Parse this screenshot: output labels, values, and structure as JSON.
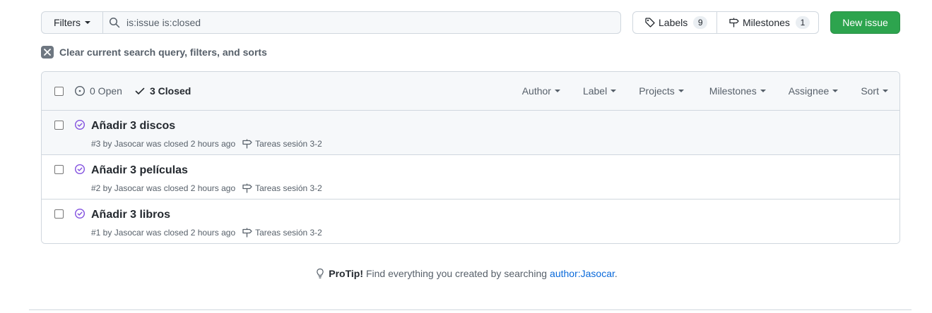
{
  "toolbar": {
    "filters_label": "Filters",
    "search_value": "is:issue is:closed",
    "labels_label": "Labels",
    "labels_count": "9",
    "milestones_label": "Milestones",
    "milestones_count": "1",
    "new_issue_label": "New issue"
  },
  "clear_filters": "Clear current search query, filters, and sorts",
  "list_header": {
    "open_label": "0 Open",
    "closed_label": "3 Closed",
    "menus": [
      "Author",
      "Label",
      "Projects",
      "Milestones",
      "Assignee",
      "Sort"
    ]
  },
  "issues": [
    {
      "title": "Añadir 3 discos",
      "meta": "#3 by Jasocar was closed 2 hours ago",
      "milestone": "Tareas sesión 3-2"
    },
    {
      "title": "Añadir 3 películas",
      "meta": "#2 by Jasocar was closed 2 hours ago",
      "milestone": "Tareas sesión 3-2"
    },
    {
      "title": "Añadir 3 libros",
      "meta": "#1 by Jasocar was closed 2 hours ago",
      "milestone": "Tareas sesión 3-2"
    }
  ],
  "protip": {
    "label": "ProTip!",
    "text": "Find everything you created by searching",
    "link": "author:Jasocar",
    "end": "."
  },
  "colors": {
    "accent_green": "#2da44e",
    "closed_purple": "#8250df",
    "link_blue": "#0969da"
  },
  "icons": {
    "search": "search-icon",
    "labels": "tag-icon",
    "milestones": "milestone-icon",
    "clear": "x-icon",
    "open": "issue-opened-icon",
    "closed": "check-icon",
    "issue_closed": "issue-closed-icon",
    "protip": "light-bulb-icon"
  }
}
